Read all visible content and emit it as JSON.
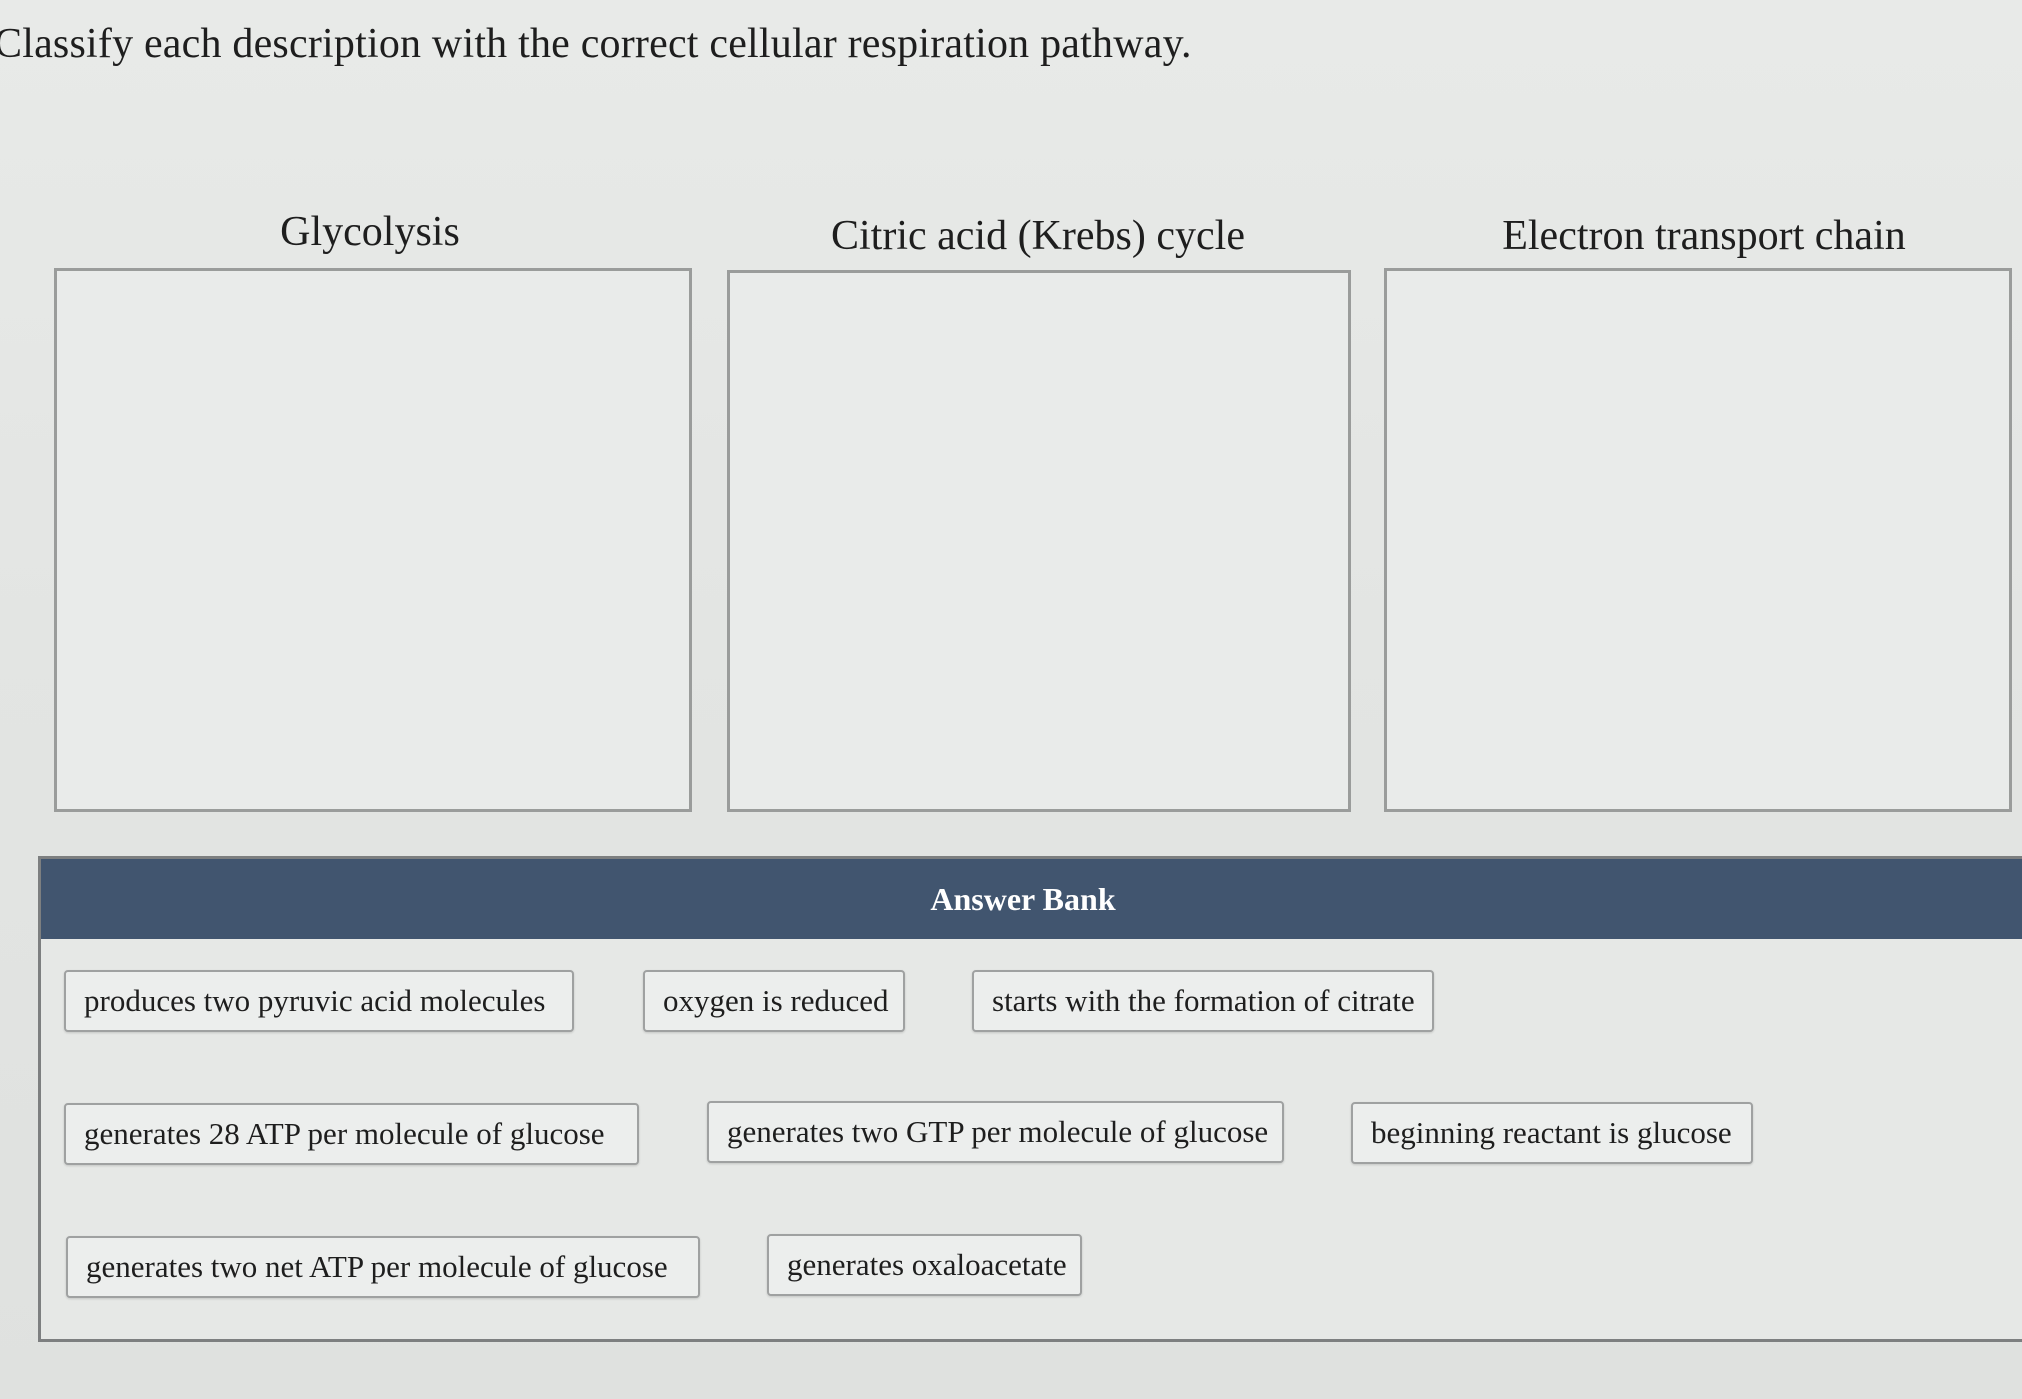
{
  "instructions": "Classify each description with the correct cellular respiration pathway.",
  "categories": [
    {
      "label": "Glycolysis"
    },
    {
      "label": "Citric acid (Krebs) cycle"
    },
    {
      "label": "Electron transport chain"
    }
  ],
  "answer_bank": {
    "title": "Answer Bank",
    "items": [
      "produces two pyruvic acid molecules",
      "oxygen is reduced",
      "starts with the formation of citrate",
      "generates 28 ATP per molecule of glucose",
      "generates two GTP per molecule of glucose",
      "beginning reactant is glucose",
      "generates two net ATP per molecule of glucose",
      "generates oxaloacetate"
    ]
  },
  "colors": {
    "header_bg": "#41556f",
    "header_text": "#ffffff",
    "page_bg": "#e4e6e4"
  }
}
